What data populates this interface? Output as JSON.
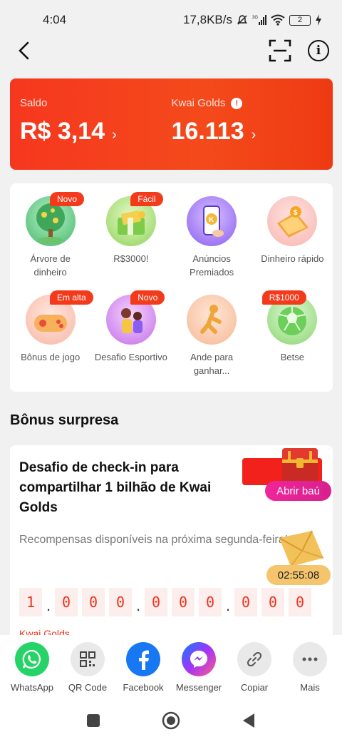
{
  "status_bar": {
    "time": "4:04",
    "speed": "17,8KB/s",
    "battery": "2"
  },
  "balance": {
    "saldo_label": "Saldo",
    "saldo_value": "R$ 3,14",
    "golds_label": "Kwai Golds",
    "golds_value": "16.113"
  },
  "grid": [
    {
      "label": "Árvore de dinheiro",
      "badge": "Novo",
      "icon": "money-tree-icon"
    },
    {
      "label": "R$3000!",
      "badge": "Fácil",
      "icon": "cash-gift-icon"
    },
    {
      "label": "Anúncios Premiados",
      "badge": "",
      "icon": "phone-coin-icon"
    },
    {
      "label": "Dinheiro rápido",
      "badge": "",
      "icon": "wallet-coin-icon"
    },
    {
      "label": "Bônus de jogo",
      "badge": "Em alta",
      "icon": "gamepad-icon"
    },
    {
      "label": "Desafio Esportivo",
      "badge": "Novo",
      "icon": "sport-challenge-icon"
    },
    {
      "label": "Ande para ganhar...",
      "badge": "",
      "icon": "walking-icon"
    },
    {
      "label": "Betse",
      "badge": "R$1000",
      "icon": "soccer-ball-icon"
    }
  ],
  "section_title": "Bônus surpresa",
  "challenge": {
    "title": "Desafio de check-in para compartilhar 1 bilhão de Kwai Golds",
    "open_button": "Abrir baú",
    "subtitle": "Recompensas disponíveis na próxima segunda-feira!",
    "timer": "02:55:08",
    "counter": [
      "1",
      ".",
      "0",
      "0",
      "0",
      ".",
      "0",
      "0",
      "0",
      ".",
      "0",
      "0",
      "0"
    ],
    "golds_label": "Kwai Golds"
  },
  "share": [
    {
      "label": "WhatsApp",
      "color": "#25d366",
      "icon": "whatsapp-icon"
    },
    {
      "label": "QR Code",
      "color": "#e9e9e9",
      "icon": "qr-code-icon"
    },
    {
      "label": "Facebook",
      "color": "#1877f2",
      "icon": "facebook-icon"
    },
    {
      "label": "Messenger",
      "color": "#8a3cf0",
      "icon": "messenger-icon"
    },
    {
      "label": "Copiar",
      "color": "#e9e9e9",
      "icon": "link-icon"
    },
    {
      "label": "Mais",
      "color": "#e9e9e9",
      "icon": "more-icon"
    }
  ],
  "colors": {
    "accent": "#f33b1c",
    "pink": "#f0259a",
    "gold": "#f4c56d"
  }
}
